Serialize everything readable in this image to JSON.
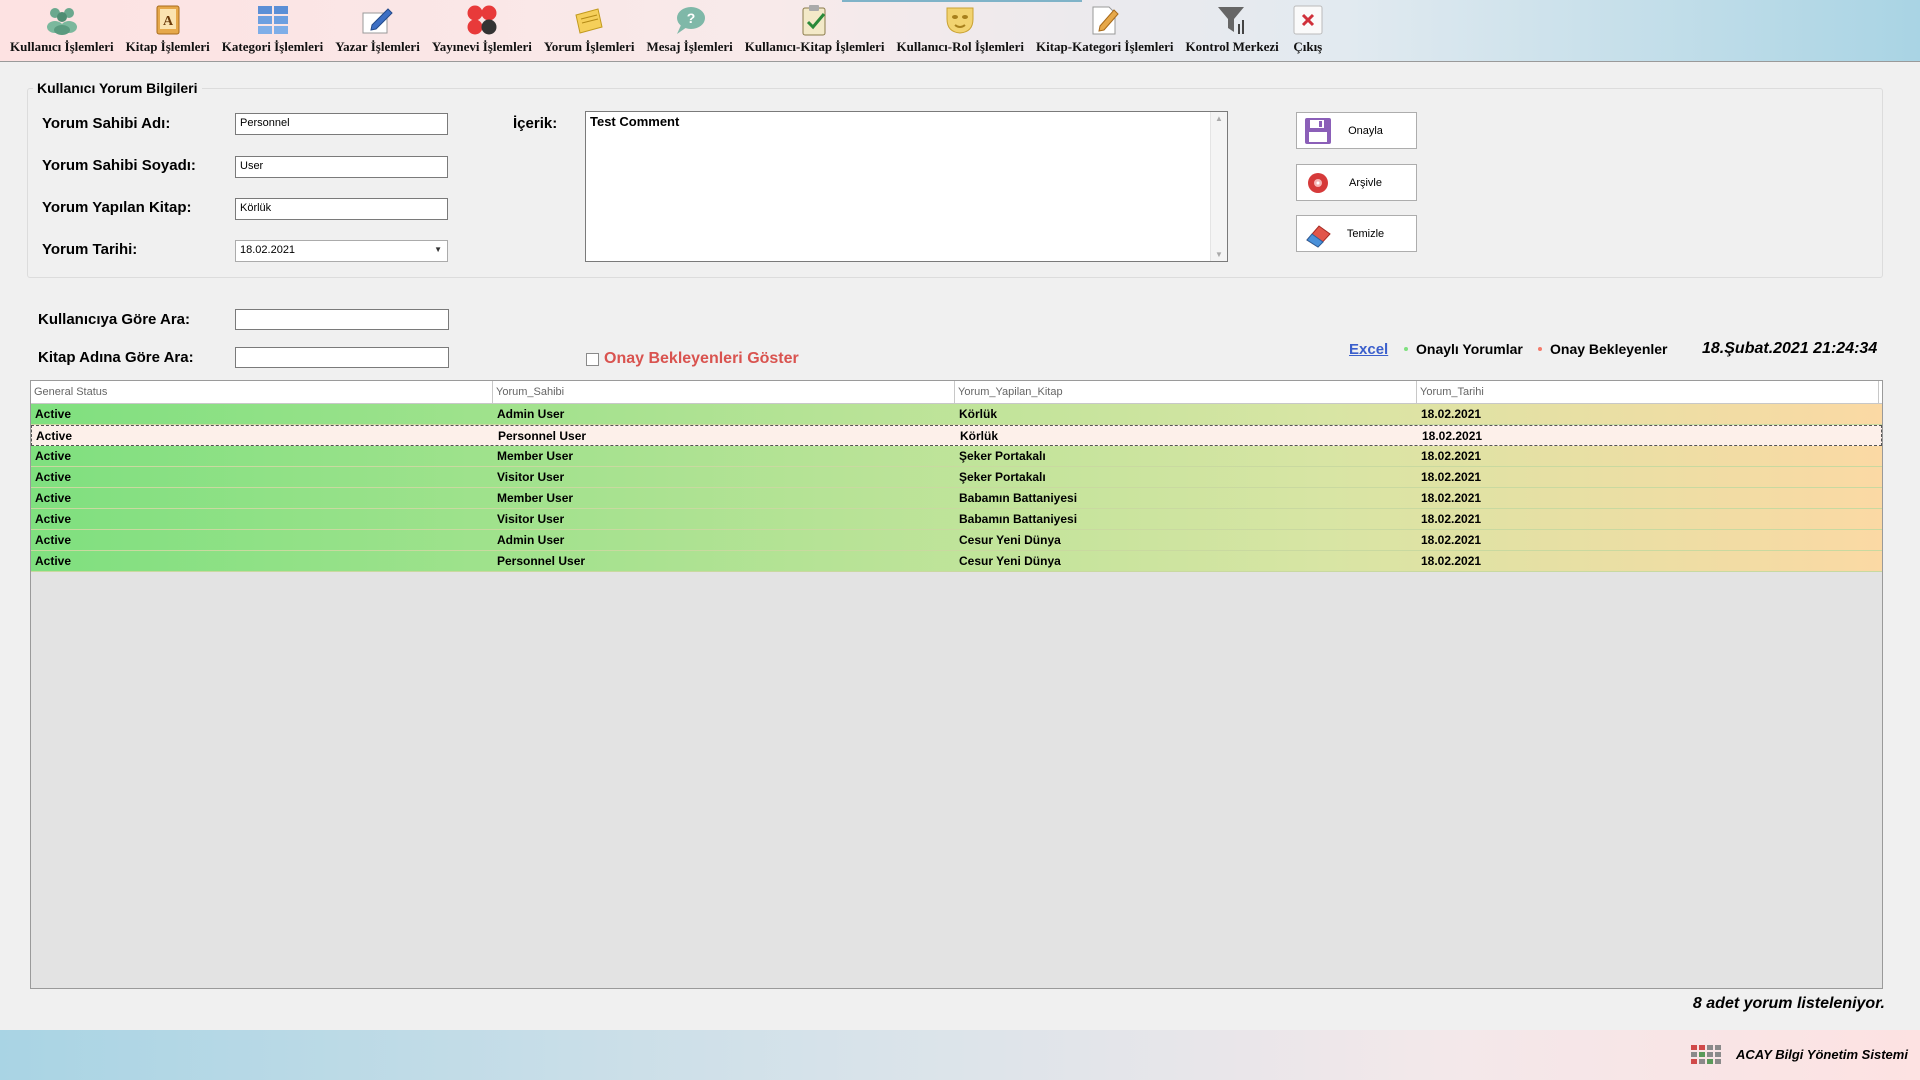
{
  "toolbar": {
    "items": [
      {
        "label": "Kullanıcı İşlemleri",
        "icon": "users-icon"
      },
      {
        "label": "Kitap İşlemleri",
        "icon": "book-icon"
      },
      {
        "label": "Kategori İşlemleri",
        "icon": "category-grid-icon"
      },
      {
        "label": "Yazar İşlemleri",
        "icon": "pen-icon"
      },
      {
        "label": "Yayınevi İşlemleri",
        "icon": "publisher-icon"
      },
      {
        "label": "Yorum İşlemleri",
        "icon": "comment-note-icon"
      },
      {
        "label": "Mesaj İşlemleri",
        "icon": "message-bubble-icon"
      },
      {
        "label": "Kullanıcı-Kitap İşlemleri",
        "icon": "clipboard-check-icon"
      },
      {
        "label": "Kullanıcı-Rol İşlemleri",
        "icon": "mask-icon"
      },
      {
        "label": "Kitap-Kategori İşlemleri",
        "icon": "document-edit-icon"
      },
      {
        "label": "Kontrol Merkezi",
        "icon": "filter-icon"
      },
      {
        "label": "Çıkış",
        "icon": "close-icon"
      }
    ]
  },
  "form": {
    "group_title": "Kullanıcı Yorum Bilgileri",
    "first_name_label": "Yorum Sahibi Adı:",
    "first_name_value": "Personnel",
    "last_name_label": "Yorum Sahibi Soyadı:",
    "last_name_value": "User",
    "book_label": "Yorum Yapılan Kitap:",
    "book_value": "Körlük",
    "date_label": "Yorum Tarihi:",
    "date_value": "18.02.2021",
    "content_label": "İçerik:",
    "content_value": "Test Comment"
  },
  "actions": {
    "approve": "Onayla",
    "archive": "Arşivle",
    "clear": "Temizle"
  },
  "search": {
    "by_user_label": "Kullanıcıya Göre Ara:",
    "by_book_label": "Kitap Adına Göre Ara:",
    "pending_checkbox": "Onay Bekleyenleri Göster"
  },
  "legend": {
    "excel": "Excel",
    "approved": "Onaylı Yorumlar",
    "pending": "Onay Bekleyenler",
    "approved_color": "#7fe07f",
    "pending_color": "#f47a6a"
  },
  "clock": "18.Şubat.2021 21:24:34",
  "grid": {
    "columns": [
      "General Status",
      "Yorum_Sahibi",
      "Yorum_Yapilan_Kitap",
      "Yorum_Tarihi"
    ],
    "rows": [
      {
        "status": "Active",
        "owner": "Admin User",
        "book": "Körlük",
        "date": "18.02.2021",
        "selected": false
      },
      {
        "status": "Active",
        "owner": "Personnel User",
        "book": "Körlük",
        "date": "18.02.2021",
        "selected": true
      },
      {
        "status": "Active",
        "owner": "Member User",
        "book": "Şeker Portakalı",
        "date": "18.02.2021",
        "selected": false
      },
      {
        "status": "Active",
        "owner": "Visitor User",
        "book": "Şeker Portakalı",
        "date": "18.02.2021",
        "selected": false
      },
      {
        "status": "Active",
        "owner": "Member User",
        "book": "Babamın Battaniyesi",
        "date": "18.02.2021",
        "selected": false
      },
      {
        "status": "Active",
        "owner": "Visitor User",
        "book": "Babamın Battaniyesi",
        "date": "18.02.2021",
        "selected": false
      },
      {
        "status": "Active",
        "owner": "Admin User",
        "book": "Cesur Yeni Dünya",
        "date": "18.02.2021",
        "selected": false
      },
      {
        "status": "Active",
        "owner": "Personnel User",
        "book": "Cesur Yeni Dünya",
        "date": "18.02.2021",
        "selected": false
      }
    ]
  },
  "status_count": "8 adet yorum listeleniyor.",
  "footer": {
    "app_name": "ACAY Bilgi Yönetim Sistemi"
  }
}
